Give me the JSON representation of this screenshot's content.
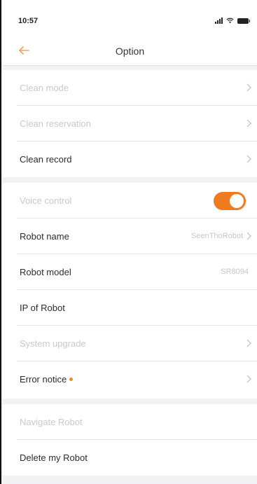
{
  "status_bar": {
    "time": "10:57"
  },
  "nav": {
    "title": "Option"
  },
  "rows": {
    "clean_mode": "Clean mode",
    "clean_reservation": "Clean reservation",
    "clean_record": "Clean record",
    "voice_control": "Voice control",
    "robot_name": "Robot name",
    "robot_name_value": "SeenThoRobot",
    "robot_model": "Robot model",
    "robot_model_value": "SR8094",
    "ip_of_robot": "IP of Robot",
    "system_upgrade": "System upgrade",
    "error_notice": "Error notice",
    "navigate_robot": "Navigate Robot",
    "delete_robot": "Delete my Robot"
  },
  "toggle": {
    "voice_control_on": true
  },
  "colors": {
    "accent": "#f07a1e",
    "background": "#f2f2f4"
  }
}
